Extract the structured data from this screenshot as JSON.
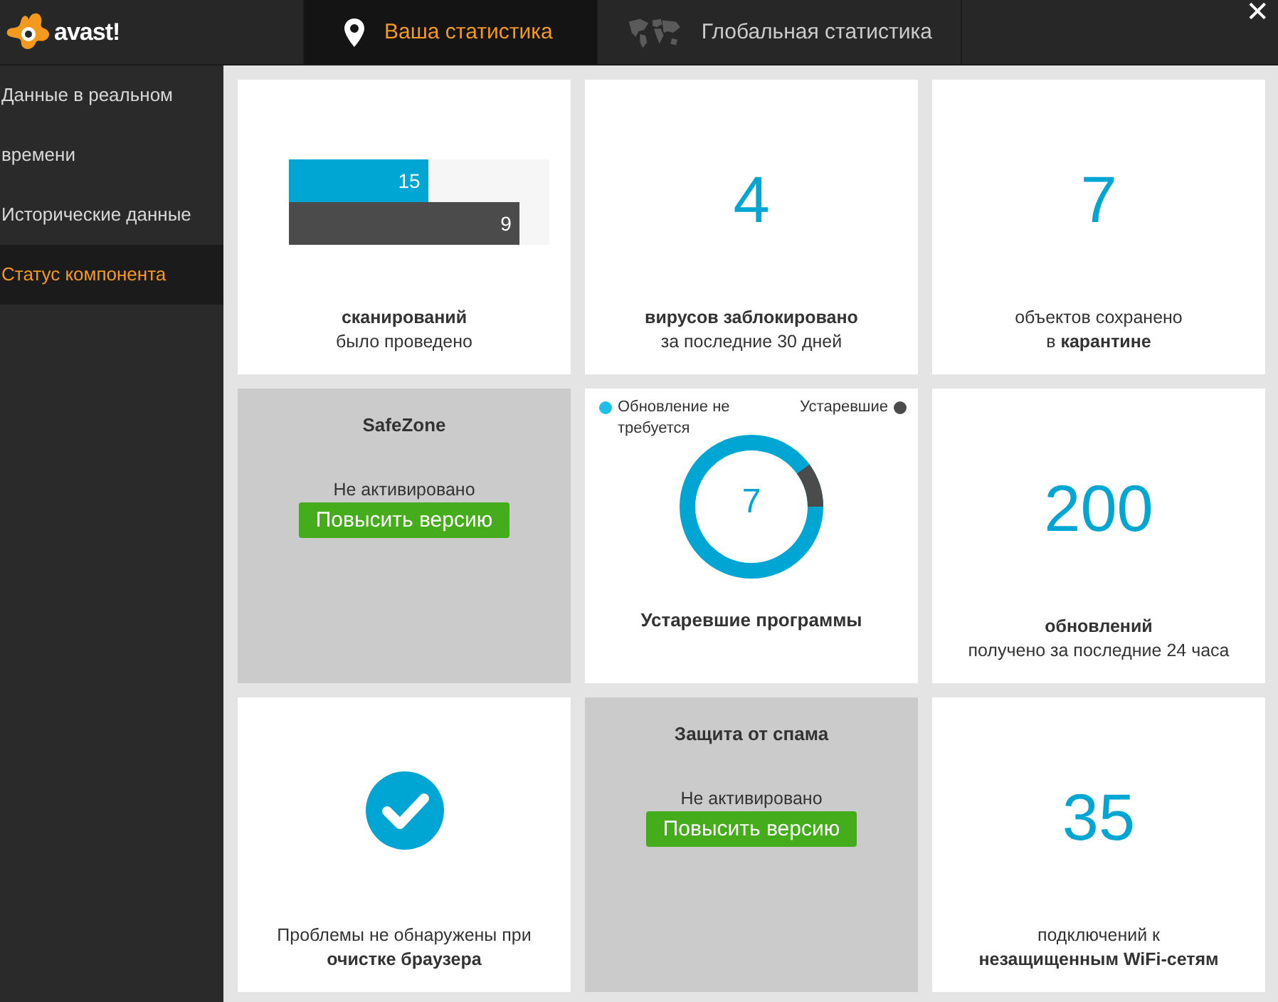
{
  "header": {
    "logo": "avast!",
    "tabs": [
      {
        "label": "Ваша статистика",
        "selected": true
      },
      {
        "label": "Глобальная статистика",
        "selected": false
      }
    ],
    "close": "✕"
  },
  "sidebar": {
    "items": [
      {
        "label": "Данные в реальном времени",
        "selected": false
      },
      {
        "label": "Исторические данные",
        "selected": false
      },
      {
        "label": "Статус компонента",
        "selected": true
      }
    ]
  },
  "tiles": [
    {
      "kind": "bars",
      "bars": [
        {
          "label": "15",
          "level": 0.54,
          "color": "#00a6d3"
        },
        {
          "label": "9",
          "level": 0.89,
          "color": "#4b4b4b"
        }
      ],
      "caption": "**сканирований**\nбыло проведено"
    },
    {
      "kind": "number",
      "value": "4",
      "caption": "**вирусов заблокировано**\nза последние 30 дней"
    },
    {
      "kind": "number",
      "value": "7",
      "caption": "объектов сохранено\nв **карантине**"
    },
    {
      "kind": "locked",
      "title": "SafeZone",
      "status": "Не активировано",
      "button": "Повысить версию"
    },
    {
      "kind": "donut",
      "legend": [
        {
          "label": "Обновление не требуется",
          "color": "#1ec0ea"
        },
        {
          "label": "Устаревшие",
          "color": "#4b4b4b"
        }
      ],
      "value": "7",
      "level": 0.1,
      "caption": "**Устаревшие программы**"
    },
    {
      "kind": "number",
      "value": "200",
      "caption": "**обновлений**\nполучено за последние 24 часа"
    },
    {
      "kind": "check",
      "caption": "Проблемы не обнаружены при\n**очистке браузера**"
    },
    {
      "kind": "locked",
      "title": "Защита от спама",
      "status": "Не активировано",
      "button": "Повысить версию"
    },
    {
      "kind": "number",
      "value": "35",
      "caption": "подключений к\n**незащищенным WiFi-сетям**"
    }
  ]
}
